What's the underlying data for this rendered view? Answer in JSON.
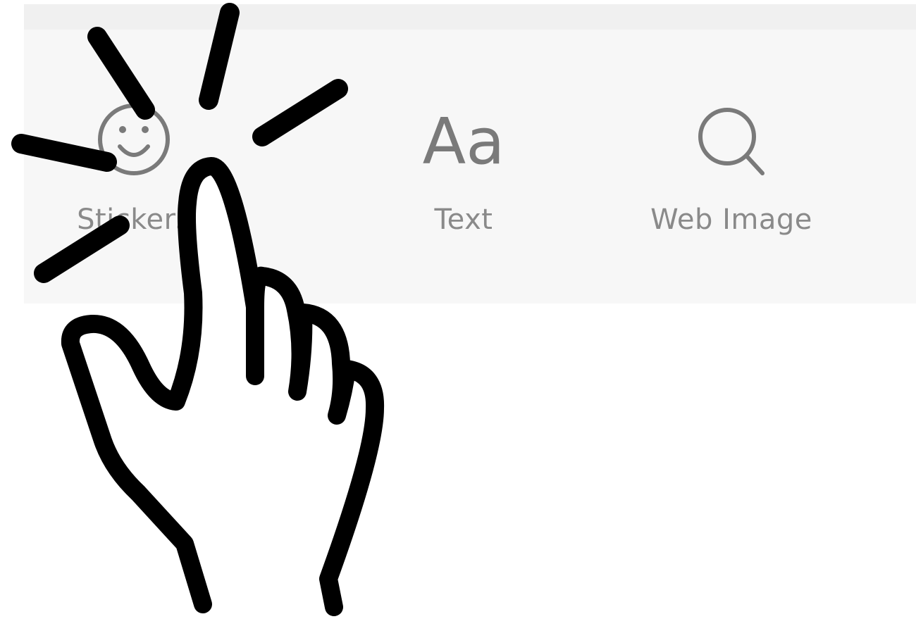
{
  "toolbar": {
    "tools": [
      {
        "label": "Stickers",
        "icon": "smiley-icon"
      },
      {
        "label": "Text",
        "icon": "text-aa-icon",
        "glyph": "Aa"
      },
      {
        "label": "Web Image",
        "icon": "search-icon"
      }
    ]
  },
  "overlay": {
    "icon": "tap-hand-icon"
  },
  "colors": {
    "toolbar_bg": "#f7f7f7",
    "top_strip_bg": "#f0f0f0",
    "icon_gray": "#7a7a7a",
    "label_gray": "#8a8a8a",
    "hand_stroke": "#000000"
  }
}
